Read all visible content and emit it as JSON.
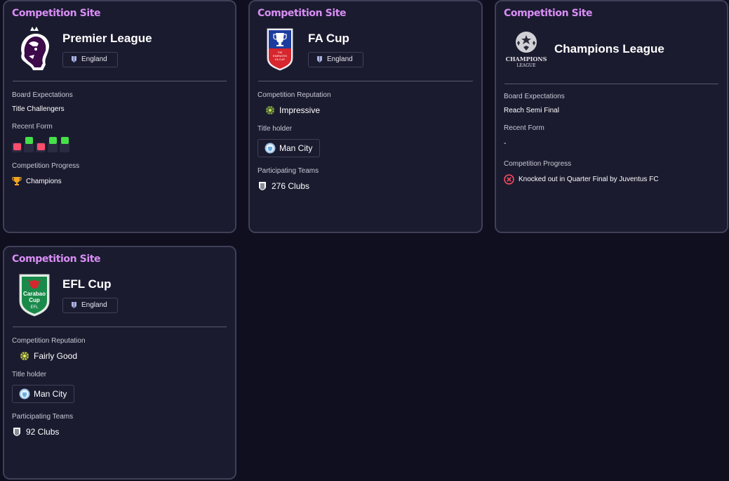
{
  "cards": [
    {
      "site_label": "Competition Site",
      "name": "Premier League",
      "country": "England",
      "rows": {
        "expectations_label": "Board Expectations",
        "expectations_value": "Title Challengers",
        "form_label": "Recent Form",
        "form": [
          "L",
          "W",
          "L",
          "W",
          "W"
        ],
        "progress_label": "Competition Progress",
        "progress_value": "Champions"
      }
    },
    {
      "site_label": "Competition Site",
      "name": "FA Cup",
      "country": "England",
      "logo_text": [
        "THE",
        "EMIRATES",
        "FA CUP"
      ],
      "rows": {
        "reputation_label": "Competition Reputation",
        "reputation_value": "Impressive",
        "holder_label": "Title holder",
        "holder_value": "Man City",
        "teams_label": "Participating Teams",
        "teams_value": "276  Clubs"
      }
    },
    {
      "site_label": "Competition Site",
      "name": "Champions League",
      "logo_text": [
        "CHAMPIONS",
        "LEAGUE"
      ],
      "rows": {
        "expectations_label": "Board Expectations",
        "expectations_value": "Reach Semi Final",
        "form_label": "Recent Form",
        "form_value": "-",
        "progress_label": "Competition Progress",
        "progress_value": "Knocked out in Quarter Final by Juventus FC"
      }
    },
    {
      "site_label": "Competition Site",
      "name": "EFL Cup",
      "country": "England",
      "logo_text": [
        "Carabao",
        "Cup",
        "EFL"
      ],
      "rows": {
        "reputation_label": "Competition Reputation",
        "reputation_value": "Fairly Good",
        "holder_label": "Title holder",
        "holder_value": "Man City",
        "teams_label": "Participating Teams",
        "teams_value": "92  Clubs"
      }
    }
  ],
  "colors": {
    "accent": "#d98ef5",
    "card_bg": "#1b1b30",
    "page_bg": "#0f0f20",
    "win": "#45e04a",
    "loss": "#ff4d6d"
  },
  "icons": {
    "country": "england-flag-icon",
    "progress_champions": "trophy-icon",
    "progress_knocked_out": "x-circle-icon",
    "reputation": "reputation-dial-icon",
    "holder": "man-city-badge-icon",
    "teams": "shield-icon"
  }
}
